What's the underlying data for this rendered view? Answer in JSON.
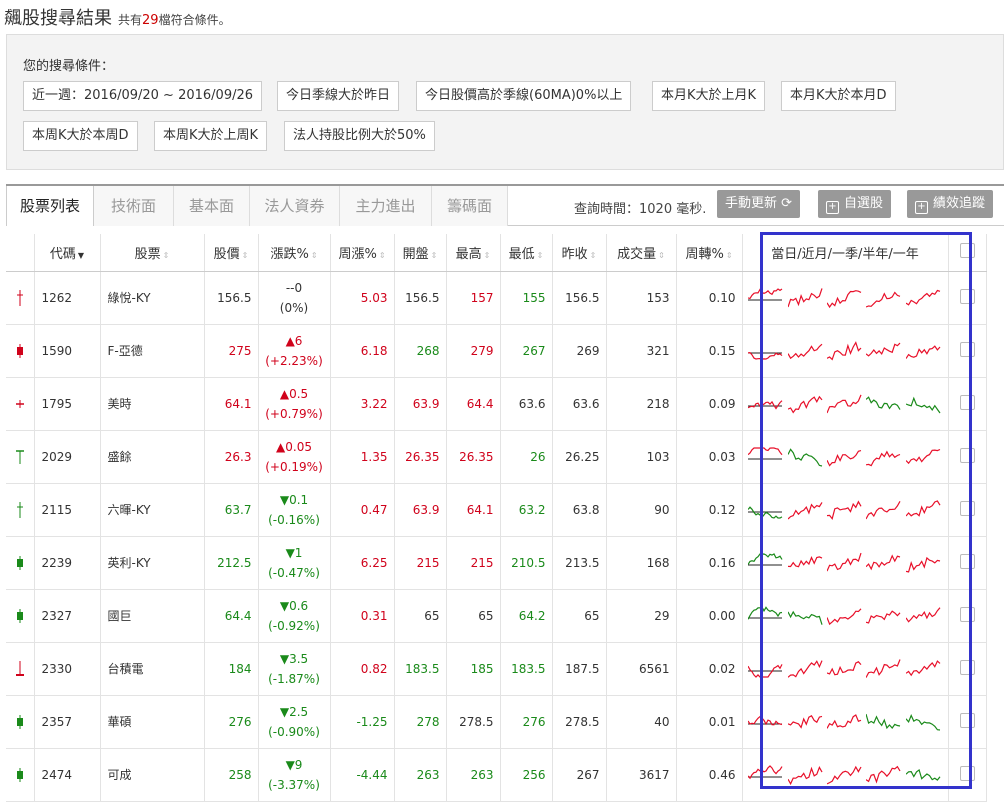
{
  "header": {
    "title": "飆股搜尋結果",
    "sub_prefix": "共有",
    "count": "29",
    "sub_suffix": "檔符合條件。"
  },
  "conditions": {
    "label": "您的搜尋條件：",
    "chips": [
      "近一週：2016/09/20 ~ 2016/09/26",
      "今日季線大於昨日",
      "今日股價高於季線(60MA)0%以上",
      "本月K大於上月K",
      "本月K大於本月D",
      "本周K大於本周D",
      "本周K大於上周K",
      "法人持股比例大於50%"
    ]
  },
  "tabs": [
    "股票列表",
    "技術面",
    "基本面",
    "法人資券",
    "主力進出",
    "籌碼面"
  ],
  "query_time": "查詢時間：1020 毫秒.",
  "buttons": {
    "refresh": "手動更新",
    "watchlist": "自選股",
    "track": "績效追蹤"
  },
  "columns": [
    "代碼",
    "股票",
    "股價",
    "漲跌%",
    "周漲%",
    "開盤",
    "最高",
    "最低",
    "昨收",
    "成交量",
    "周轉%",
    "當日/近月/一季/半年/一年"
  ],
  "rows": [
    {
      "code": "1262",
      "name": "綠悅-KY",
      "price": "156.5",
      "chg": "--0",
      "pct": "(0%)",
      "dir": "flat",
      "week": "5.03",
      "open": "156.5",
      "high": "157",
      "low": "155",
      "prev": "156.5",
      "vol": "153",
      "turn": "0.10",
      "k": "cross",
      "kc": "#d0021b"
    },
    {
      "code": "1590",
      "name": "F-亞德",
      "price": "275",
      "chg": "▲6",
      "pct": "(+2.23%)",
      "dir": "up",
      "week": "6.18",
      "open": "268",
      "high": "279",
      "low": "267",
      "prev": "269",
      "vol": "321",
      "turn": "0.15",
      "k": "bar",
      "kc": "#d0021b"
    },
    {
      "code": "1795",
      "name": "美時",
      "price": "64.1",
      "chg": "▲0.5",
      "pct": "(+0.79%)",
      "dir": "up",
      "week": "3.22",
      "open": "63.9",
      "high": "64.4",
      "low": "63.6",
      "prev": "63.6",
      "vol": "218",
      "turn": "0.09",
      "k": "plus",
      "kc": "#d0021b"
    },
    {
      "code": "2029",
      "name": "盛餘",
      "price": "26.3",
      "chg": "▲0.05",
      "pct": "(+0.19%)",
      "dir": "up",
      "week": "1.35",
      "open": "26.35",
      "high": "26.35",
      "low": "26",
      "prev": "26.25",
      "vol": "103",
      "turn": "0.03",
      "k": "tee",
      "kc": "#1a8a1a"
    },
    {
      "code": "2115",
      "name": "六暉-KY",
      "price": "63.7",
      "chg": "▼0.1",
      "pct": "(-0.16%)",
      "dir": "dn",
      "week": "0.47",
      "open": "63.9",
      "high": "64.1",
      "low": "63.2",
      "prev": "63.8",
      "vol": "90",
      "turn": "0.12",
      "k": "cross",
      "kc": "#1a8a1a"
    },
    {
      "code": "2239",
      "name": "英利-KY",
      "price": "212.5",
      "chg": "▼1",
      "pct": "(-0.47%)",
      "dir": "dn",
      "week": "6.25",
      "open": "215",
      "high": "215",
      "low": "210.5",
      "prev": "213.5",
      "vol": "168",
      "turn": "0.16",
      "k": "bar",
      "kc": "#1a8a1a"
    },
    {
      "code": "2327",
      "name": "國巨",
      "price": "64.4",
      "chg": "▼0.6",
      "pct": "(-0.92%)",
      "dir": "dn",
      "week": "0.31",
      "open": "65",
      "high": "65",
      "low": "64.2",
      "prev": "65",
      "vol": "29",
      "turn": "0.00",
      "k": "bar",
      "kc": "#1a8a1a"
    },
    {
      "code": "2330",
      "name": "台積電",
      "price": "184",
      "chg": "▼3.5",
      "pct": "(-1.87%)",
      "dir": "dn",
      "week": "0.82",
      "open": "183.5",
      "high": "185",
      "low": "183.5",
      "prev": "187.5",
      "vol": "6561",
      "turn": "0.02",
      "k": "inv",
      "kc": "#d0021b"
    },
    {
      "code": "2357",
      "name": "華碩",
      "price": "276",
      "chg": "▼2.5",
      "pct": "(-0.90%)",
      "dir": "dn",
      "week": "-1.25",
      "open": "278",
      "high": "278.5",
      "low": "276",
      "prev": "278.5",
      "vol": "40",
      "turn": "0.01",
      "k": "bar",
      "kc": "#1a8a1a"
    },
    {
      "code": "2474",
      "name": "可成",
      "price": "258",
      "chg": "▼9",
      "pct": "(-3.37%)",
      "dir": "dn",
      "week": "-4.44",
      "open": "263",
      "high": "263",
      "low": "256",
      "prev": "267",
      "vol": "3617",
      "turn": "0.46",
      "k": "bar",
      "kc": "#1a8a1a"
    }
  ],
  "spark_colors": {
    "up": "#e8102a",
    "down": "#1a8a1a"
  },
  "sparks": [
    [
      "up",
      "up",
      "up",
      "up",
      "up"
    ],
    [
      "up",
      "up",
      "up",
      "up",
      "up"
    ],
    [
      "up",
      "up",
      "up",
      "down",
      "down"
    ],
    [
      "up",
      "down",
      "up",
      "up",
      "up"
    ],
    [
      "down",
      "up",
      "up",
      "up",
      "up"
    ],
    [
      "down",
      "up",
      "up",
      "up",
      "up"
    ],
    [
      "down",
      "down",
      "up",
      "up",
      "up"
    ],
    [
      "up",
      "up",
      "up",
      "up",
      "up"
    ],
    [
      "up",
      "up",
      "up",
      "down",
      "down"
    ],
    [
      "up",
      "up",
      "up",
      "up",
      "down"
    ]
  ]
}
